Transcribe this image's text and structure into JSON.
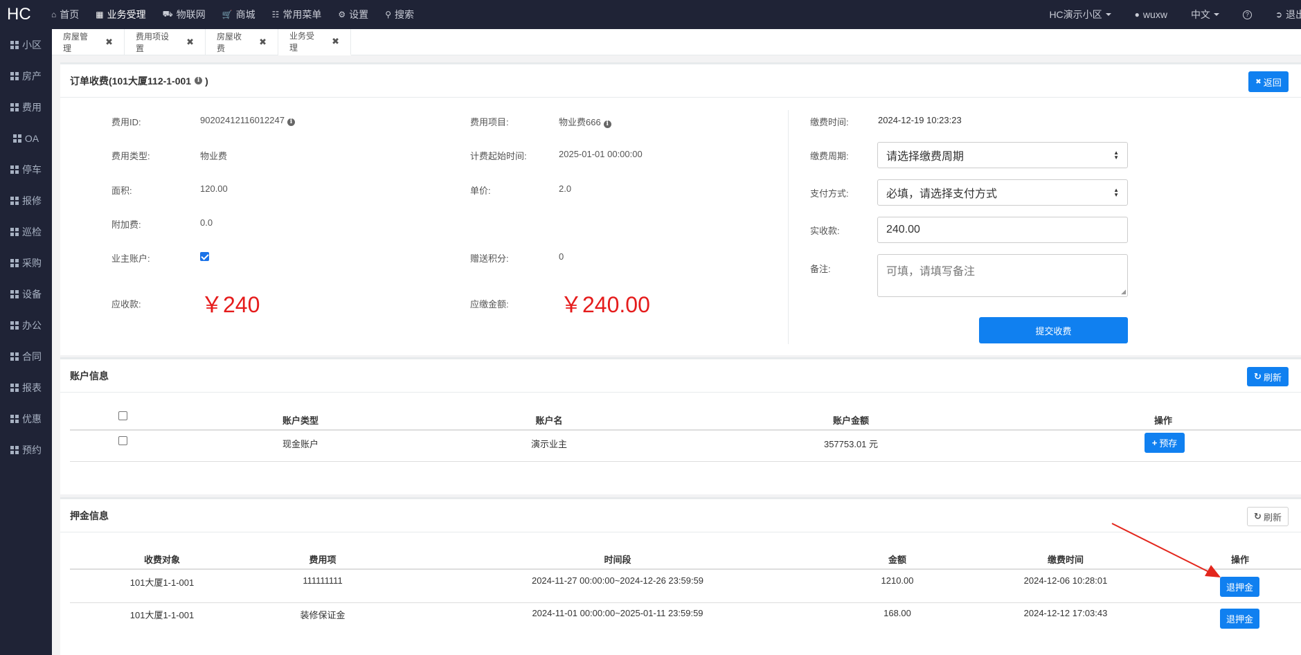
{
  "topnav": {
    "logo": "HC",
    "items": [
      {
        "icon": "home-icon",
        "label": "首页"
      },
      {
        "icon": "calculator-icon",
        "label": "业务受理"
      },
      {
        "icon": "car-icon",
        "label": "物联网"
      },
      {
        "icon": "cart-icon",
        "label": "商城"
      },
      {
        "icon": "sitemap-icon",
        "label": "常用菜单"
      },
      {
        "icon": "gear-icon",
        "label": "设置"
      },
      {
        "icon": "search-icon",
        "label": "搜索"
      }
    ],
    "community": "HC演示小区",
    "user": "wuxw",
    "language": "中文",
    "help": "?",
    "logout": "退出"
  },
  "sidebar": {
    "items": [
      "小区",
      "房产",
      "费用",
      "OA",
      "停车",
      "报修",
      "巡检",
      "采购",
      "设备",
      "办公",
      "合同",
      "报表",
      "优惠",
      "预约"
    ]
  },
  "tabs": [
    "房屋管理",
    "费用项设置",
    "房屋收费",
    "业务受理"
  ],
  "order": {
    "title": "订单收费(101大厦112-1-001",
    "title_end": ")",
    "back_label": "返回",
    "fee_id_label": "费用ID:",
    "fee_id": "90202412116012247",
    "fee_item_label": "费用项目:",
    "fee_item": "物业费666",
    "fee_type_label": "费用类型:",
    "fee_type": "物业费",
    "start_time_label": "计费起始时间:",
    "start_time": "2025-01-01 00:00:00",
    "area_label": "面积:",
    "area": "120.00",
    "unit_price_label": "单价:",
    "unit_price": "2.0",
    "extra_fee_label": "附加费:",
    "extra_fee": "0.0",
    "owner_account_label": "业主账户:",
    "owner_account_checked": true,
    "points_label": "赠送积分:",
    "points": "0",
    "receivable_label": "应收款:",
    "receivable": "￥240",
    "payable_label": "应缴金额:",
    "payable": "￥240.00",
    "pay_time_label": "缴费时间:",
    "pay_time": "2024-12-19 10:23:23",
    "cycle_label": "缴费周期:",
    "cycle_value": "请选择缴费周期",
    "method_label": "支付方式:",
    "method_value": "必填，请选择支付方式",
    "received_label": "实收款:",
    "received_value": "240.00",
    "remark_label": "备注:",
    "remark_placeholder": "可填，请填写备注",
    "submit_label": "提交收费"
  },
  "account": {
    "title": "账户信息",
    "refresh_label": "刷新",
    "headers": [
      "账户类型",
      "账户名",
      "账户金额",
      "操作"
    ],
    "rows": [
      {
        "type": "现金账户",
        "name": "演示业主",
        "amount": "357753.01 元",
        "action": "预存"
      }
    ]
  },
  "deposit": {
    "title": "押金信息",
    "refresh_label": "刷新",
    "headers": [
      "收费对象",
      "费用项",
      "时间段",
      "金额",
      "缴费时间",
      "操作"
    ],
    "rows": [
      {
        "target": "101大厦1-1-001",
        "item": "111111111",
        "period": "2024-11-27 00:00:00~2024-12-26 23:59:59",
        "amount": "1210.00",
        "pay_time": "2024-12-06 10:28:01",
        "action": "退押金"
      },
      {
        "target": "101大厦1-1-001",
        "item": "装修保证金",
        "period": "2024-11-01 00:00:00~2025-01-11 23:59:59",
        "amount": "168.00",
        "pay_time": "2024-12-12 17:03:43",
        "action": "退押金"
      }
    ]
  },
  "colors": {
    "accent": "#1080f0",
    "nav_bg": "#1f2336",
    "money": "#e51c1c",
    "arrow": "#e3261c"
  }
}
